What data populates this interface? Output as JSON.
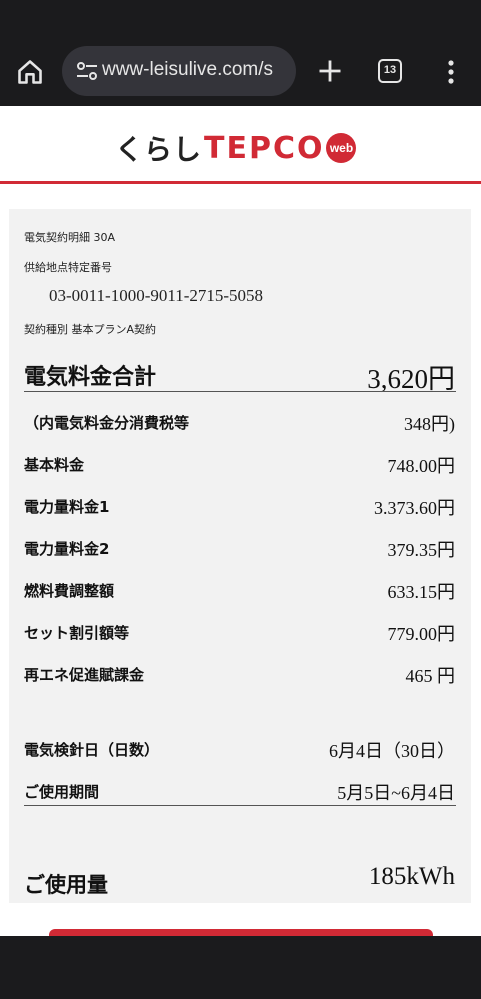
{
  "browser": {
    "url": "www-leisulive.com/s",
    "tab_count": "13"
  },
  "site": {
    "logo_kurashi": "くらし",
    "logo_brand": "TEPCO",
    "logo_badge": "web"
  },
  "bill": {
    "contract_detail": "電気契約明細 30A",
    "supply_point_label": "供給地点特定番号",
    "supply_point_number": "03-0011-1000-9011-2715-5058",
    "contract_type": "契約種別 基本プランA契約",
    "total_label": "電気料金合計",
    "total_value": "3,620円",
    "rows": [
      {
        "label": "（内電気料金分消費税等",
        "value": "348円)"
      },
      {
        "label": "基本料金",
        "value": "748.00円"
      },
      {
        "label": "電力量料金1",
        "value": "3.373.60円"
      },
      {
        "label": "電力量料金2",
        "value": "379.35円"
      },
      {
        "label": "燃料費調整額",
        "value": "633.15円"
      },
      {
        "label": "セット割引額等",
        "value": "779.00円"
      },
      {
        "label": "再エネ促進賦課金",
        "value": "465 円"
      }
    ],
    "reading_label": "電気検針日（日数）",
    "reading_value": "6月4日（30日）",
    "period_label": "ご使用期間",
    "period_value": "5月5日~6月4日",
    "usage_label": "ご使用量",
    "usage_value": "185kWh"
  },
  "colors": {
    "brand_red": "#d12a35",
    "browser_chrome": "#1b1b1d",
    "card_bg": "#f2f2f2"
  }
}
